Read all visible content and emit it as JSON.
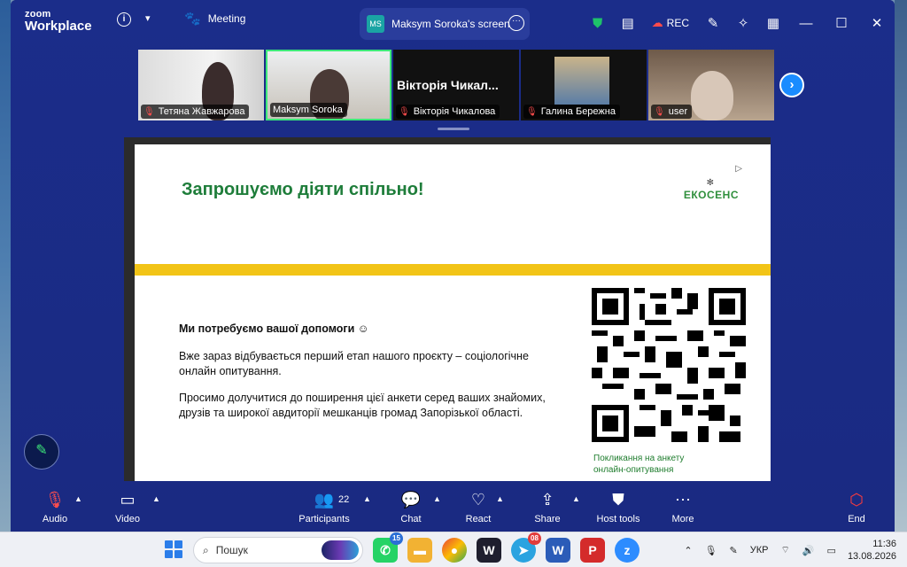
{
  "app": {
    "logo_line1": "zoom",
    "logo_line2": "Workplace"
  },
  "titlebar": {
    "meeting_label": "Meeting",
    "share_tab_badge": "MS",
    "share_tab_label": "Maksym Soroka's screen",
    "rec_label": "REC"
  },
  "participants_strip": [
    {
      "name": "Тетяна Жавжарова"
    },
    {
      "name": "Maksym Soroka"
    },
    {
      "name": "Віктoрія Чикалова",
      "big_name": "Віктoрія Чикал..."
    },
    {
      "name": "Галина Бережна"
    },
    {
      "name": "user"
    }
  ],
  "slide": {
    "title": "Запрошуємо діяти спільно!",
    "brand": "ЕКОСЕНС",
    "heading": "Ми потребуємо вашої допомоги ☺",
    "paragraph1": "Вже зараз відбувається перший етап нашого проєкту – соціологічне онлайн опитування.",
    "paragraph2": "Просимо долучитися до поширення цієї анкети серед ваших знайомих, друзів та широкої авдиторії мешканців громад Запорізької області.",
    "qr_caption_line1": "Покликання на анкету",
    "qr_caption_line2": "онлайн-опитування"
  },
  "toolbar": {
    "audio": "Audio",
    "video": "Video",
    "participants": "Participants",
    "participants_count": "22",
    "chat": "Chat",
    "react": "React",
    "share": "Share",
    "host_tools": "Host tools",
    "more": "More",
    "end": "End"
  },
  "taskbar": {
    "search_placeholder": "Пошук",
    "whatsapp_badge": "15",
    "telegram_badge": "08",
    "lang": "УКР",
    "time": "11:36",
    "date": "13.08.2026"
  },
  "colors": {
    "zoom_bg": "#1b2d8a",
    "accent_green": "#1e7d3a",
    "yellow_bar": "#f2c417",
    "end_red": "#ff3b3b"
  }
}
